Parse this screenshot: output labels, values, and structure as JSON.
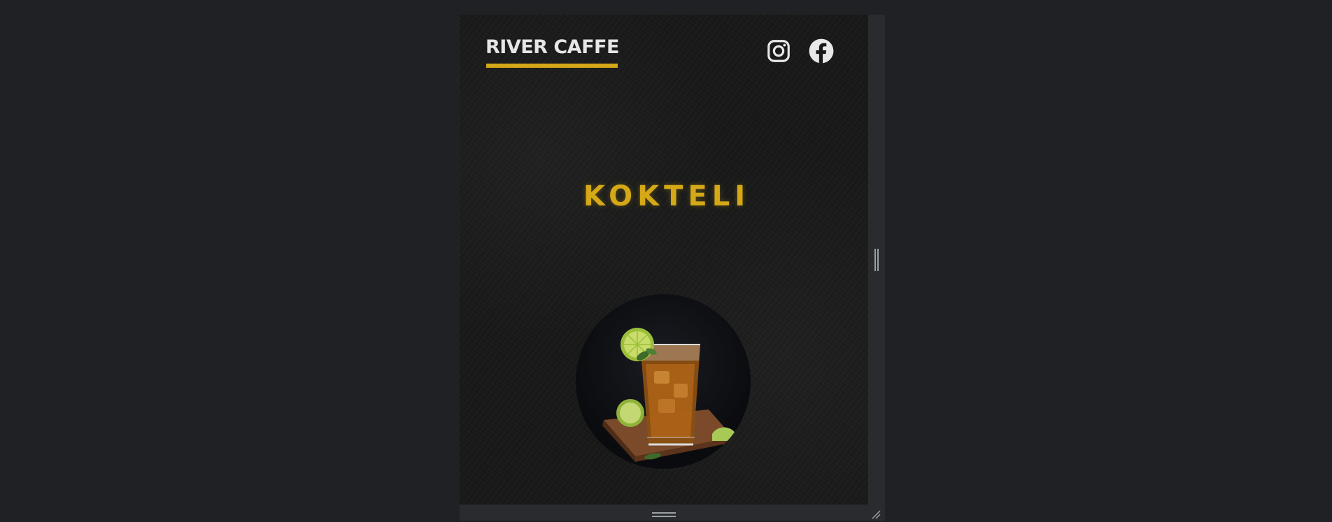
{
  "header": {
    "logo_text": "RIVER CAFFE",
    "accent_color": "#d4a817",
    "social": [
      {
        "name": "instagram-icon"
      },
      {
        "name": "facebook-icon"
      }
    ]
  },
  "hero": {
    "title": "KOKTELI",
    "image_icon": "cocktail-glass-with-lime"
  },
  "emulator": {
    "resize_handles": [
      "right",
      "bottom",
      "corner"
    ]
  }
}
